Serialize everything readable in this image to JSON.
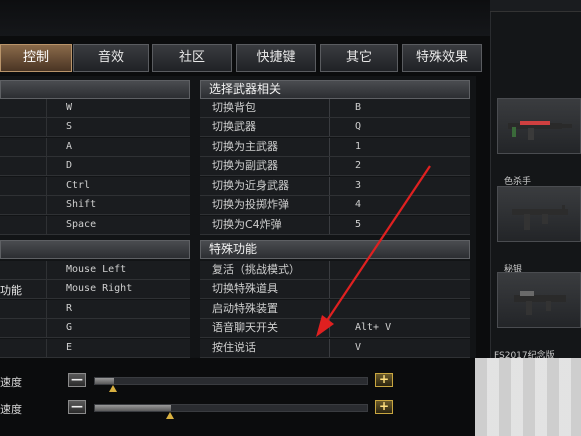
{
  "tabs": [
    {
      "label": "控制",
      "active": true
    },
    {
      "label": "音效",
      "active": false
    },
    {
      "label": "社区",
      "active": false
    },
    {
      "label": "快捷键",
      "active": false
    },
    {
      "label": "其它",
      "active": false
    },
    {
      "label": "特殊效果",
      "active": false
    }
  ],
  "movement_keys": [
    "W",
    "S",
    "A",
    "D",
    "Ctrl",
    "Shift",
    "Space"
  ],
  "weapon_section": {
    "title": "选择武器相关",
    "rows": [
      {
        "action": "切换背包",
        "key": "B"
      },
      {
        "action": "切换武器",
        "key": "Q"
      },
      {
        "action": "切换为主武器",
        "key": "1"
      },
      {
        "action": "切换为副武器",
        "key": "2"
      },
      {
        "action": "切换为近身武器",
        "key": "3"
      },
      {
        "action": "切换为投掷炸弹",
        "key": "4"
      },
      {
        "action": "切换为C4炸弹",
        "key": "5"
      }
    ]
  },
  "attack_section": {
    "partial_label": "功能",
    "keys": [
      "Mouse Left",
      "Mouse Right",
      "R",
      "G",
      "E"
    ]
  },
  "special_section": {
    "title": "特殊功能",
    "rows": [
      {
        "action": "复活（挑战模式）",
        "key": ""
      },
      {
        "action": "切换特殊道具",
        "key": ""
      },
      {
        "action": "启动特殊装置",
        "key": ""
      },
      {
        "action": "语音聊天开关",
        "key": "Alt+ V"
      },
      {
        "action": "按住说话",
        "key": "V"
      }
    ]
  },
  "sliders": [
    {
      "label": "速度",
      "minus": "—",
      "plus": "+",
      "level": 0.07
    },
    {
      "label": "速度",
      "minus": "—",
      "plus": "+",
      "level": 0.28
    }
  ],
  "inventory": {
    "labels": [
      "色杀手",
      "秘银",
      "FS2017纪念版"
    ]
  },
  "colors": {
    "accent_tab": "#8a6a4a",
    "annotation_arrow": "#e02020"
  }
}
